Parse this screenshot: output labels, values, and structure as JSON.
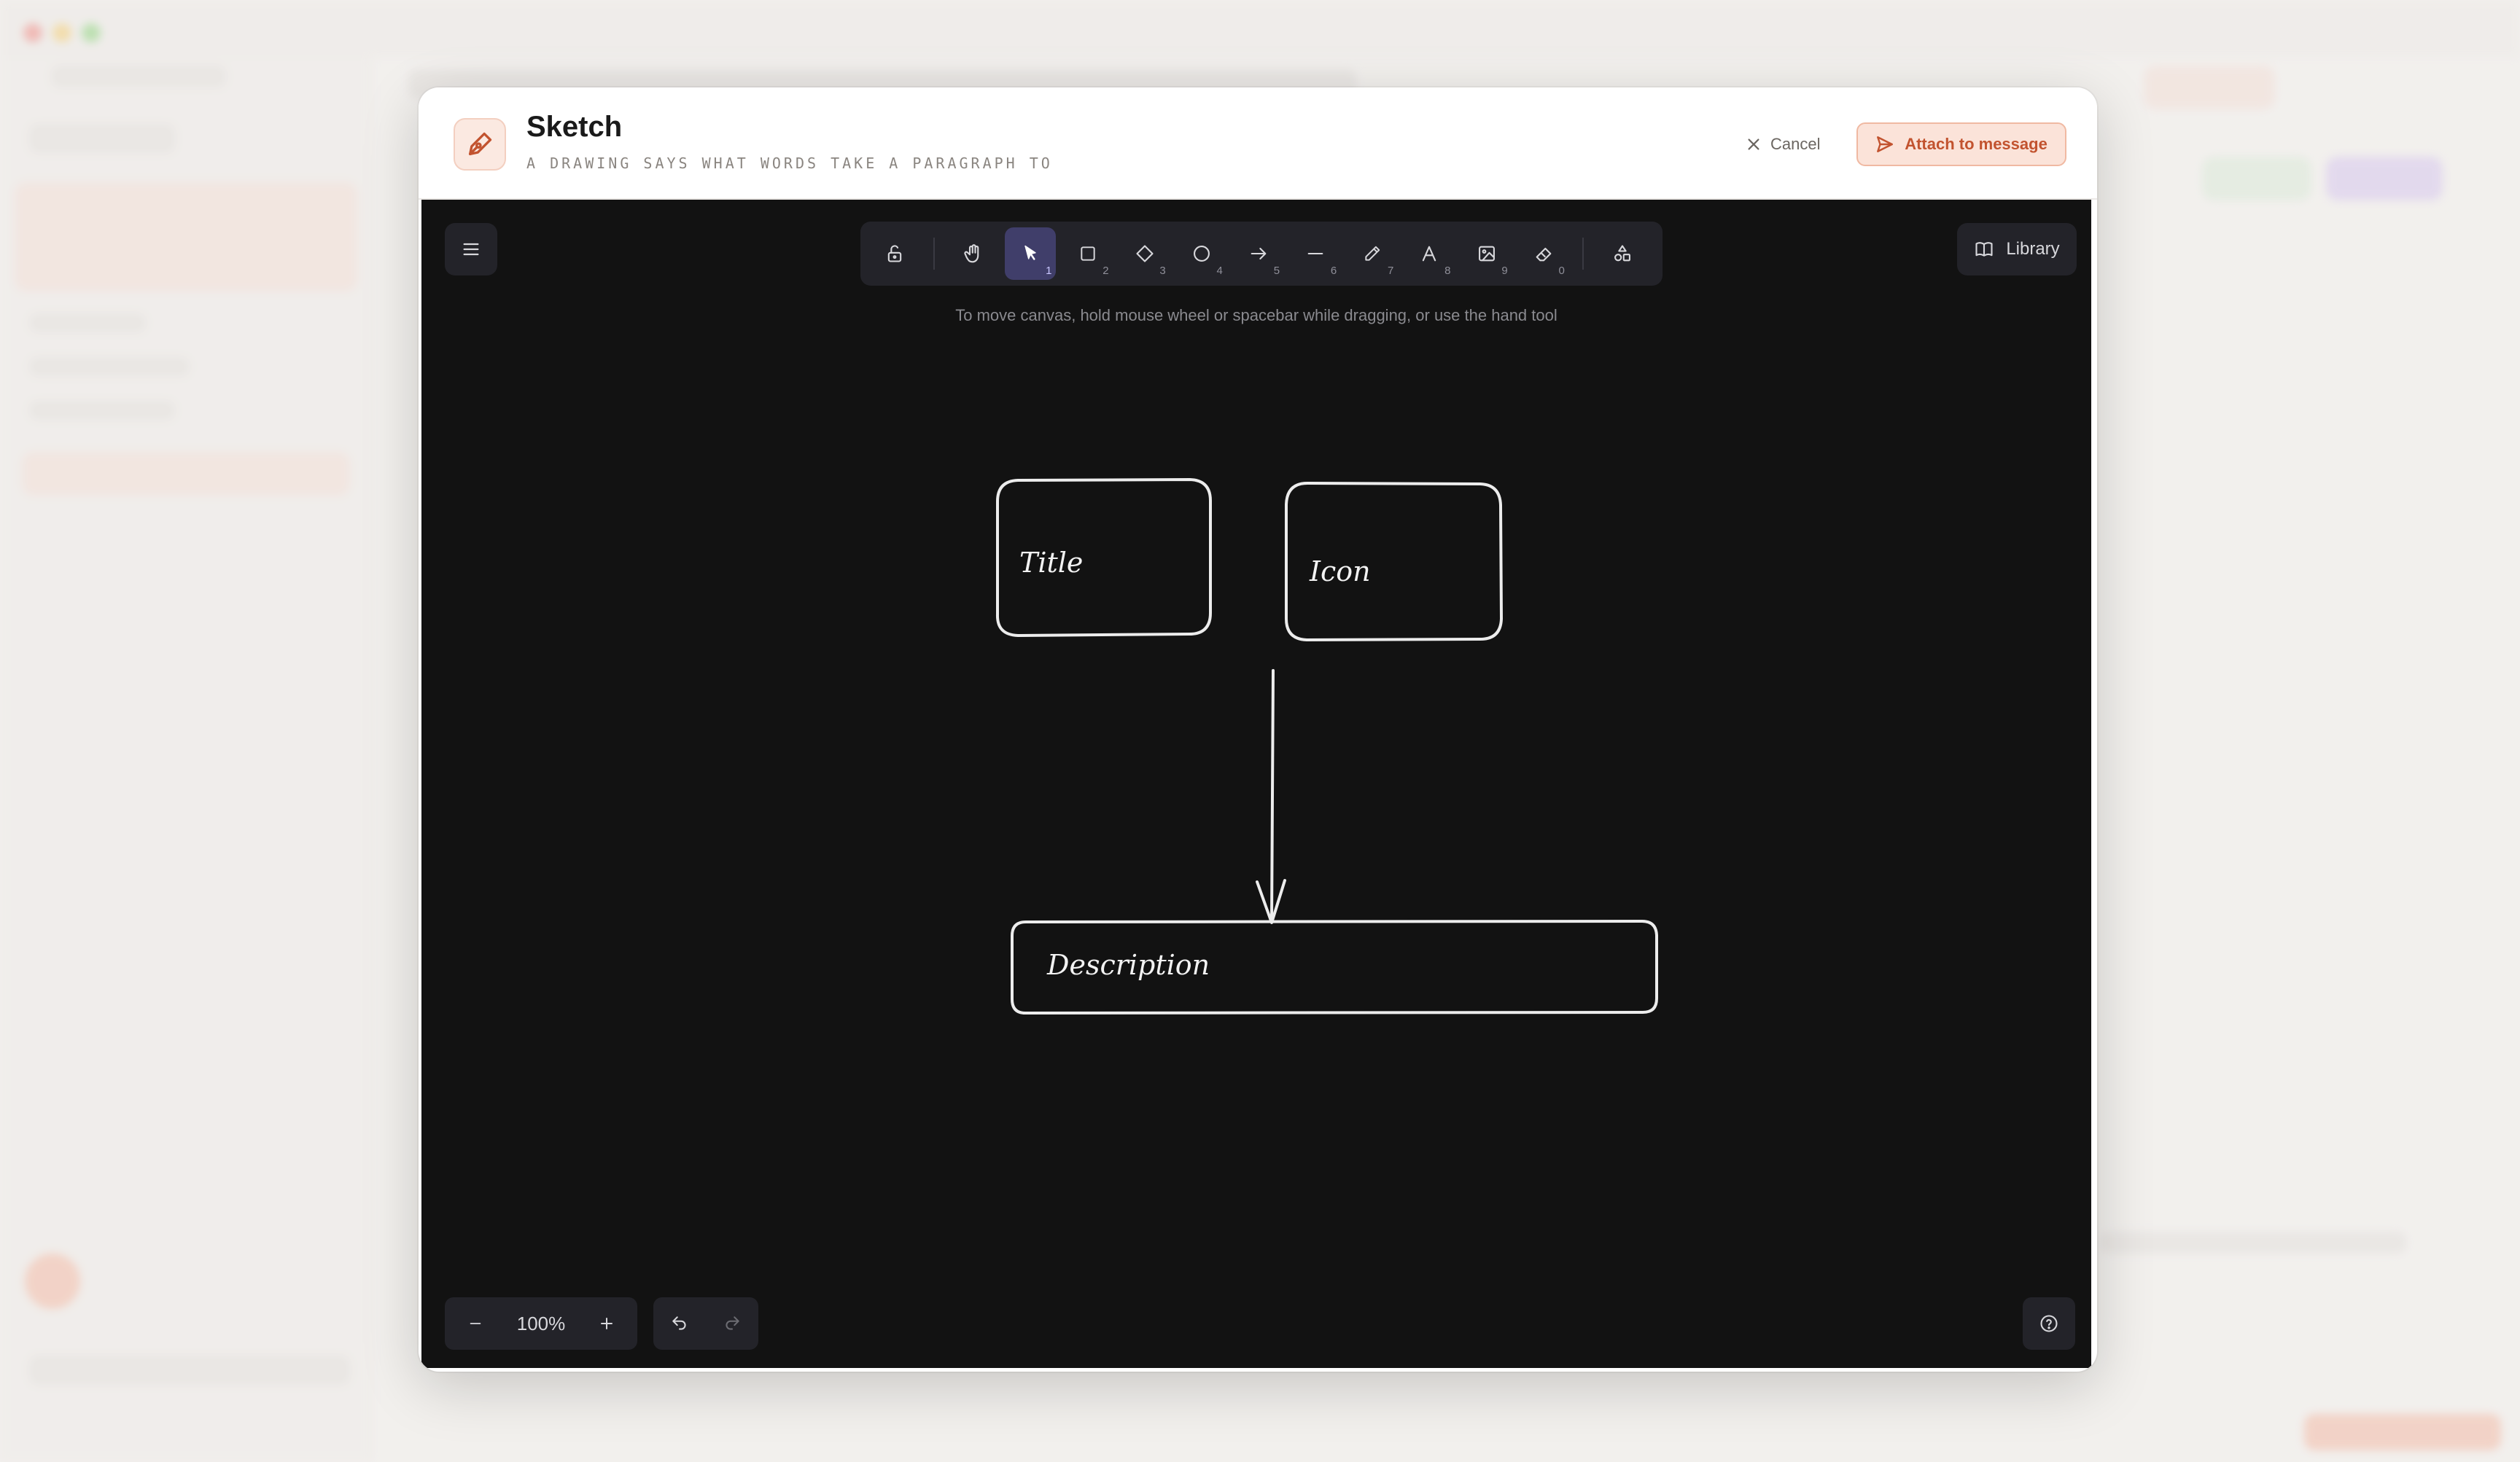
{
  "modal": {
    "title": "Sketch",
    "subtitle": "A DRAWING SAYS WHAT WORDS TAKE A PARAGRAPH TO",
    "cancel_label": "Cancel",
    "attach_label": "Attach to message"
  },
  "canvas": {
    "hint": "To move canvas, hold mouse wheel or spacebar while dragging, or use the hand tool",
    "library_label": "Library",
    "zoom_level": "100%",
    "toolbar": [
      {
        "name": "lock-tool",
        "key": ""
      },
      {
        "name": "hand-tool",
        "key": ""
      },
      {
        "name": "selection-tool",
        "key": "1",
        "active": true
      },
      {
        "name": "rectangle-tool",
        "key": "2"
      },
      {
        "name": "diamond-tool",
        "key": "3"
      },
      {
        "name": "ellipse-tool",
        "key": "4"
      },
      {
        "name": "arrow-tool",
        "key": "5"
      },
      {
        "name": "line-tool",
        "key": "6"
      },
      {
        "name": "draw-tool",
        "key": "7"
      },
      {
        "name": "text-tool",
        "key": "8"
      },
      {
        "name": "image-tool",
        "key": "9"
      },
      {
        "name": "eraser-tool",
        "key": "0"
      },
      {
        "name": "extra-tools",
        "key": ""
      }
    ],
    "shapes": {
      "title_label": "Title",
      "icon_label": "Icon",
      "description_label": "Description"
    }
  },
  "colors": {
    "accent": "#c2532f",
    "canvas_bg": "#121212",
    "active_tool": "#403e6a"
  }
}
